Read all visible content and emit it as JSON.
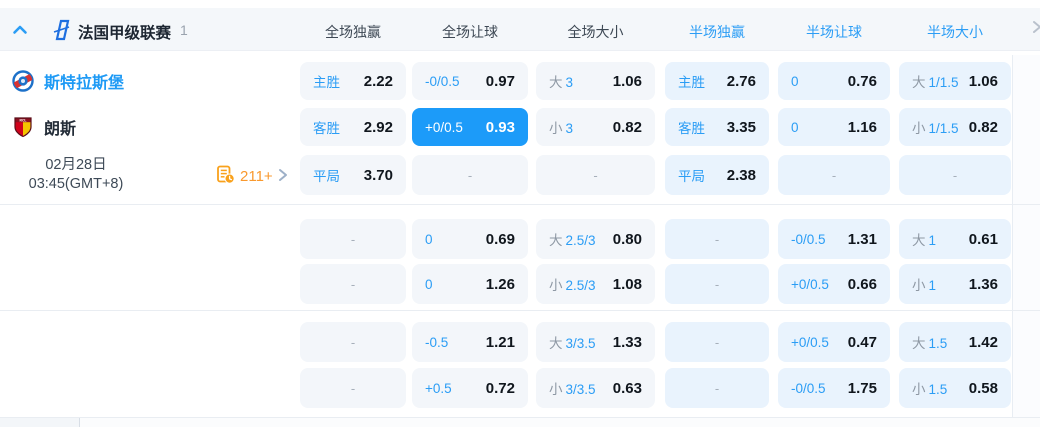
{
  "header": {
    "league_name": "法国甲级联赛",
    "league_count": "1",
    "full_columns": [
      "全场独赢",
      "全场让球",
      "全场大小"
    ],
    "half_columns": [
      "半场独赢",
      "半场让球",
      "半场大小"
    ]
  },
  "match": {
    "home_team": "斯特拉斯堡",
    "away_team": "朗斯",
    "date": "02月28日",
    "time": "03:45(GMT+8)",
    "markets_count": "211+"
  },
  "odds": {
    "dash": "-",
    "rows": [
      [
        {
          "l": "主胜",
          "v": "2.22"
        },
        {
          "l": "-0/0.5",
          "v": "0.97"
        },
        {
          "p": "大",
          "l": "3",
          "v": "1.06"
        },
        {
          "l": "主胜",
          "v": "2.76"
        },
        {
          "l": "0",
          "v": "0.76"
        },
        {
          "p": "大",
          "l": "1/1.5",
          "v": "1.06"
        }
      ],
      [
        {
          "l": "客胜",
          "v": "2.92"
        },
        {
          "l": "+0/0.5",
          "v": "0.93",
          "hl": true
        },
        {
          "p": "小",
          "l": "3",
          "v": "0.82"
        },
        {
          "l": "客胜",
          "v": "3.35"
        },
        {
          "l": "0",
          "v": "1.16"
        },
        {
          "p": "小",
          "l": "1/1.5",
          "v": "0.82"
        }
      ],
      [
        {
          "l": "平局",
          "v": "3.70"
        },
        {
          "dash": true
        },
        {
          "dash": true
        },
        {
          "l": "平局",
          "v": "2.38"
        },
        {
          "dash": true
        },
        {
          "dash": true
        }
      ],
      [
        {
          "dash": true
        },
        {
          "l": "0",
          "v": "0.69"
        },
        {
          "p": "大",
          "l": "2.5/3",
          "v": "0.80"
        },
        {
          "dash": true
        },
        {
          "l": "-0/0.5",
          "v": "1.31"
        },
        {
          "p": "大",
          "l": "1",
          "v": "0.61"
        }
      ],
      [
        {
          "dash": true
        },
        {
          "l": "0",
          "v": "1.26"
        },
        {
          "p": "小",
          "l": "2.5/3",
          "v": "1.08"
        },
        {
          "dash": true
        },
        {
          "l": "+0/0.5",
          "v": "0.66"
        },
        {
          "p": "小",
          "l": "1",
          "v": "1.36"
        }
      ],
      [
        {
          "dash": true
        },
        {
          "l": "-0.5",
          "v": "1.21"
        },
        {
          "p": "大",
          "l": "3/3.5",
          "v": "1.33"
        },
        {
          "dash": true
        },
        {
          "l": "+0/0.5",
          "v": "0.47"
        },
        {
          "p": "大",
          "l": "1.5",
          "v": "1.42"
        }
      ],
      [
        {
          "dash": true
        },
        {
          "l": "+0.5",
          "v": "0.72"
        },
        {
          "p": "小",
          "l": "3/3.5",
          "v": "0.63"
        },
        {
          "dash": true
        },
        {
          "l": "-0/0.5",
          "v": "1.75"
        },
        {
          "p": "小",
          "l": "1.5",
          "v": "0.58"
        }
      ]
    ]
  },
  "colors": {
    "accent_blue": "#2b9df5",
    "highlight_bg": "#1c9bf9",
    "orange": "#f9a11b",
    "full_cell_bg": "#f3f6fa",
    "half_cell_bg": "#e9f3fd"
  }
}
